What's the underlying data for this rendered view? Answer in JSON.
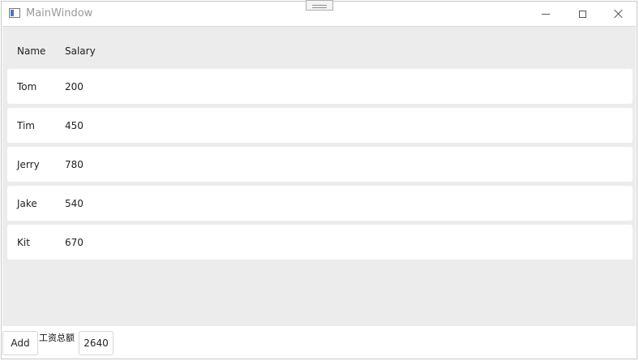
{
  "window": {
    "title": "MainWindow",
    "icon": "window-app-icon",
    "controls": [
      "minimize-icon",
      "maximize-icon",
      "close-icon"
    ]
  },
  "table": {
    "columns": [
      "Name",
      "Salary"
    ],
    "rows": [
      {
        "name": "Tom",
        "salary": "200"
      },
      {
        "name": "Tim",
        "salary": "450"
      },
      {
        "name": "Jerry",
        "salary": "780"
      },
      {
        "name": "Jake",
        "salary": "540"
      },
      {
        "name": "Kit",
        "salary": "670"
      }
    ]
  },
  "footer": {
    "add_label": "Add",
    "total_label": "工资总额",
    "total_value": "2640"
  },
  "colors": {
    "list_background": "#ececec",
    "row_background": "#ffffff",
    "title_text": "#9a9a9a"
  }
}
